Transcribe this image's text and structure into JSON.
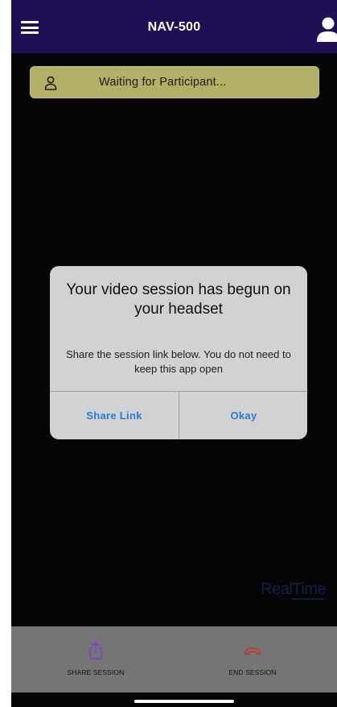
{
  "header": {
    "title": "NAV-500",
    "menu_icon": "hamburger-menu-icon",
    "profile_icon": "user-profile-icon",
    "background": "#1f0f54"
  },
  "status": {
    "text": "Waiting for Participant...",
    "icon": "user-outline-icon",
    "background": "#b0b067"
  },
  "dialog": {
    "title": "Your video session has begun on your headset",
    "message": "Share the session link below. You do not need to keep this app open",
    "buttons": {
      "share_link": "Share Link",
      "okay": "Okay"
    },
    "button_color": "#2a7bd6"
  },
  "watermark": {
    "text": "RealTime"
  },
  "bottom_bar": {
    "share_session": {
      "label": "SHARE SESSION",
      "icon": "share-upload-icon",
      "icon_color": "#7b3fd0"
    },
    "end_session": {
      "label": "END SESSION",
      "icon": "hang-up-phone-icon",
      "icon_color": "#c4302b"
    }
  }
}
